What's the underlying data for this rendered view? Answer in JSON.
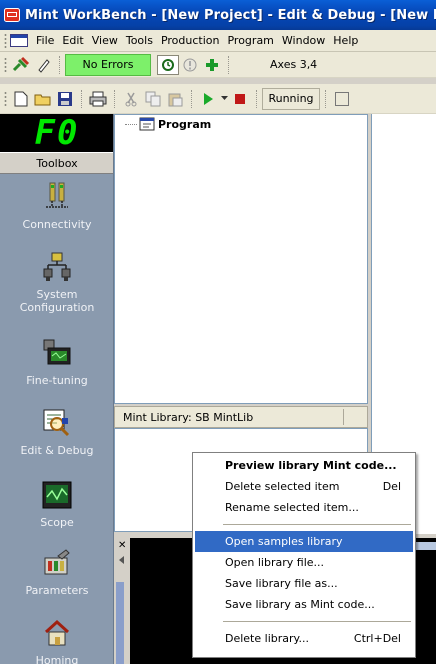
{
  "window": {
    "title": "Mint WorkBench - [New Project] - Edit & Debug - [New Mi"
  },
  "menu": [
    "File",
    "Edit",
    "View",
    "Tools",
    "Production",
    "Program",
    "Window",
    "Help"
  ],
  "toolbar1": {
    "status": "No Errors",
    "axes": "Axes 3,4"
  },
  "toolbar2": {
    "run_state": "Running"
  },
  "drive_display": "F0",
  "toolbox": {
    "header": "Toolbox",
    "items": [
      {
        "label": "Connectivity",
        "icon": "connectivity-icon"
      },
      {
        "label": "System Configuration",
        "icon": "system-configuration-icon"
      },
      {
        "label": "Fine-tuning",
        "icon": "fine-tuning-icon"
      },
      {
        "label": "Edit & Debug",
        "icon": "edit-debug-icon"
      },
      {
        "label": "Scope",
        "icon": "scope-icon"
      },
      {
        "label": "Parameters",
        "icon": "parameters-icon"
      },
      {
        "label": "Homing",
        "icon": "homing-icon"
      }
    ]
  },
  "tree": {
    "root": "Program"
  },
  "library": {
    "header": "Mint Library: SB MintLib"
  },
  "context_menu": {
    "items": [
      {
        "label": "Preview library Mint code...",
        "shortcut": ""
      },
      {
        "label": "Delete selected item",
        "shortcut": "Del"
      },
      {
        "label": "Rename selected item...",
        "shortcut": ""
      },
      {
        "label": "Open samples library",
        "shortcut": ""
      },
      {
        "label": "Open library file...",
        "shortcut": ""
      },
      {
        "label": "Save library file as...",
        "shortcut": ""
      },
      {
        "label": "Save library as Mint code...",
        "shortcut": ""
      },
      {
        "label": "Delete library...",
        "shortcut": "Ctrl+Del"
      }
    ],
    "highlighted": "Open samples library"
  },
  "colors": {
    "title_bar": "#0548b4",
    "status_ok": "#7df06a",
    "toolbox_bg": "#8a9aae",
    "menu_highlight": "#316ac5",
    "display_digits": "#00e800"
  }
}
